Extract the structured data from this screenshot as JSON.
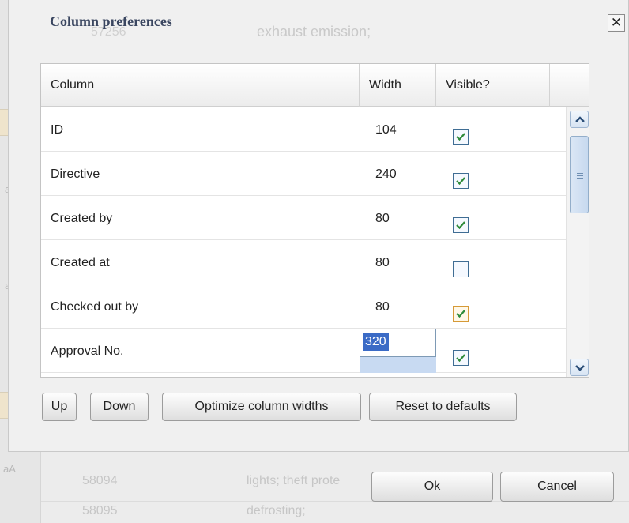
{
  "dialog": {
    "title": "Column preferences",
    "close_glyph": "✕",
    "background_ghost_text": "exhaust emission;",
    "background_ghost_number": "57256"
  },
  "grid": {
    "headers": [
      "Column",
      "Width",
      "Visible?"
    ],
    "rows": [
      {
        "name": "ID",
        "width": "104",
        "visible": true
      },
      {
        "name": "Directive",
        "width": "240",
        "visible": true
      },
      {
        "name": "Created by",
        "width": "80",
        "visible": true
      },
      {
        "name": "Created at",
        "width": "80",
        "visible": false
      },
      {
        "name": "Checked out by",
        "width": "80",
        "visible": true
      },
      {
        "name": "Approval No.",
        "width": "320",
        "visible": true
      }
    ],
    "editing_value": "320"
  },
  "buttons": {
    "up": "Up",
    "down": "Down",
    "optimize": "Optimize column widths",
    "reset": "Reset to defaults",
    "ok": "Ok",
    "cancel": "Cancel"
  },
  "background_rows": [
    {
      "id": "58094",
      "text": "lights; theft prote"
    },
    {
      "id": "58095",
      "text": "defrosting;"
    }
  ],
  "background_side_labels": [
    "a",
    "a",
    "aA"
  ],
  "colors": {
    "check_border": "#3f6d94",
    "check_mark": "#2e8b3a",
    "selection": "#3b6bc6"
  }
}
